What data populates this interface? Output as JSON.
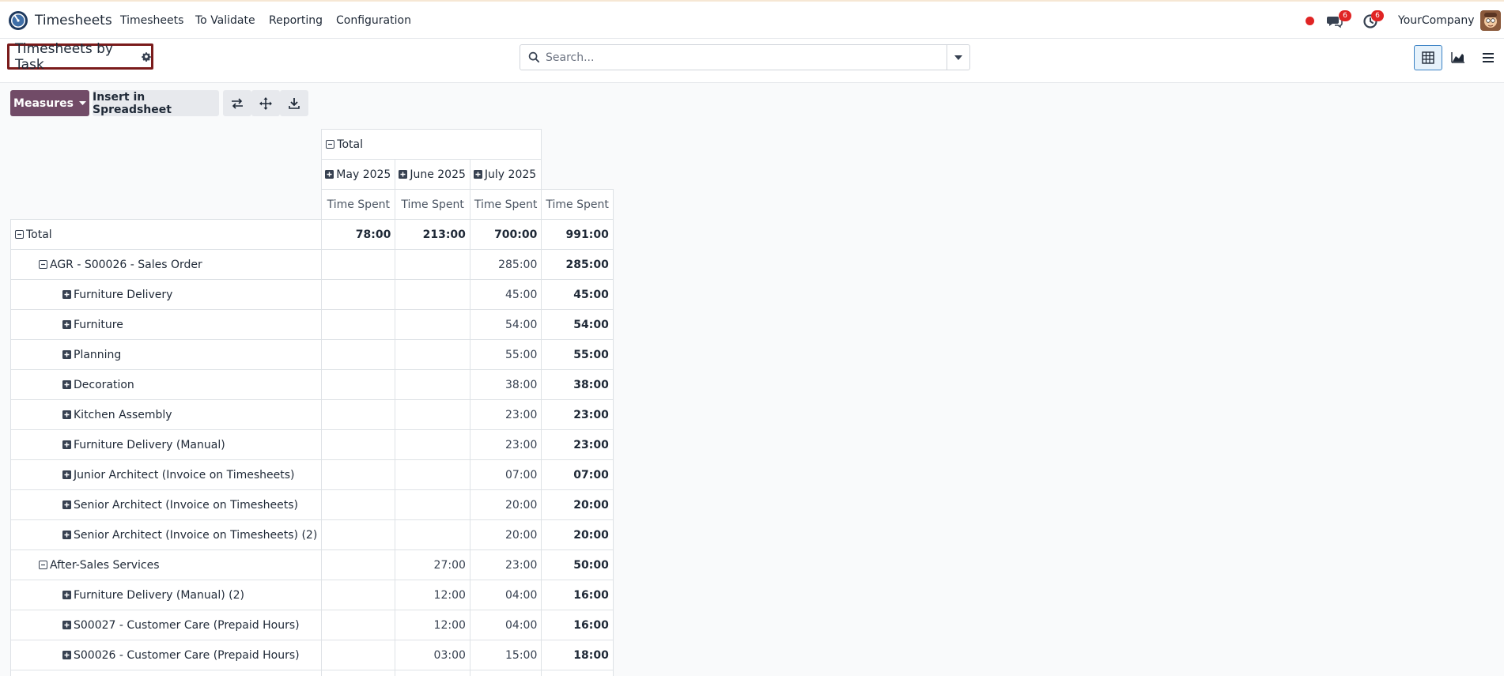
{
  "app": {
    "name": "Timesheets",
    "menu": [
      "Timesheets",
      "To Validate",
      "Reporting",
      "Configuration"
    ],
    "messages_badge": "6",
    "activities_badge": "6",
    "company": "YourCompany"
  },
  "control": {
    "breadcrumb": "Timesheets by Task",
    "search_placeholder": "Search..."
  },
  "toolbar": {
    "measures": "Measures",
    "insert": "Insert in Spreadsheet"
  },
  "pivot": {
    "col_total": "Total",
    "months": [
      "May 2025",
      "June 2025",
      "July 2025"
    ],
    "measure": "Time Spent",
    "rows": [
      {
        "label": "Total",
        "level": 0,
        "expanded": true,
        "bold": true,
        "values": [
          "78:00",
          "213:00",
          "700:00",
          "991:00"
        ]
      },
      {
        "label": "AGR - S00026 - Sales Order",
        "level": 1,
        "expanded": true,
        "bold": false,
        "values": [
          "",
          "",
          "285:00",
          "285:00"
        ]
      },
      {
        "label": "Furniture Delivery",
        "level": 2,
        "expanded": false,
        "bold": false,
        "values": [
          "",
          "",
          "45:00",
          "45:00"
        ]
      },
      {
        "label": "Furniture",
        "level": 2,
        "expanded": false,
        "bold": false,
        "values": [
          "",
          "",
          "54:00",
          "54:00"
        ]
      },
      {
        "label": "Planning",
        "level": 2,
        "expanded": false,
        "bold": false,
        "values": [
          "",
          "",
          "55:00",
          "55:00"
        ]
      },
      {
        "label": "Decoration",
        "level": 2,
        "expanded": false,
        "bold": false,
        "values": [
          "",
          "",
          "38:00",
          "38:00"
        ]
      },
      {
        "label": "Kitchen Assembly",
        "level": 2,
        "expanded": false,
        "bold": false,
        "values": [
          "",
          "",
          "23:00",
          "23:00"
        ]
      },
      {
        "label": "Furniture Delivery (Manual)",
        "level": 2,
        "expanded": false,
        "bold": false,
        "values": [
          "",
          "",
          "23:00",
          "23:00"
        ]
      },
      {
        "label": "Junior Architect (Invoice on Timesheets)",
        "level": 2,
        "expanded": false,
        "bold": false,
        "values": [
          "",
          "",
          "07:00",
          "07:00"
        ]
      },
      {
        "label": "Senior Architect (Invoice on Timesheets)",
        "level": 2,
        "expanded": false,
        "bold": false,
        "values": [
          "",
          "",
          "20:00",
          "20:00"
        ]
      },
      {
        "label": "Senior Architect (Invoice on Timesheets) (2)",
        "level": 2,
        "expanded": false,
        "bold": false,
        "values": [
          "",
          "",
          "20:00",
          "20:00"
        ]
      },
      {
        "label": "After-Sales Services",
        "level": 1,
        "expanded": true,
        "bold": false,
        "values": [
          "",
          "27:00",
          "23:00",
          "50:00"
        ]
      },
      {
        "label": "Furniture Delivery (Manual) (2)",
        "level": 2,
        "expanded": false,
        "bold": false,
        "values": [
          "",
          "12:00",
          "04:00",
          "16:00"
        ]
      },
      {
        "label": "S00027 - Customer Care (Prepaid Hours)",
        "level": 2,
        "expanded": false,
        "bold": false,
        "values": [
          "",
          "12:00",
          "04:00",
          "16:00"
        ]
      },
      {
        "label": "S00026 - Customer Care (Prepaid Hours)",
        "level": 2,
        "expanded": false,
        "bold": false,
        "values": [
          "",
          "03:00",
          "15:00",
          "18:00"
        ]
      },
      {
        "label": "",
        "level": 2,
        "expanded": false,
        "bold": false,
        "values": [
          "",
          "",
          "",
          ""
        ]
      }
    ]
  }
}
